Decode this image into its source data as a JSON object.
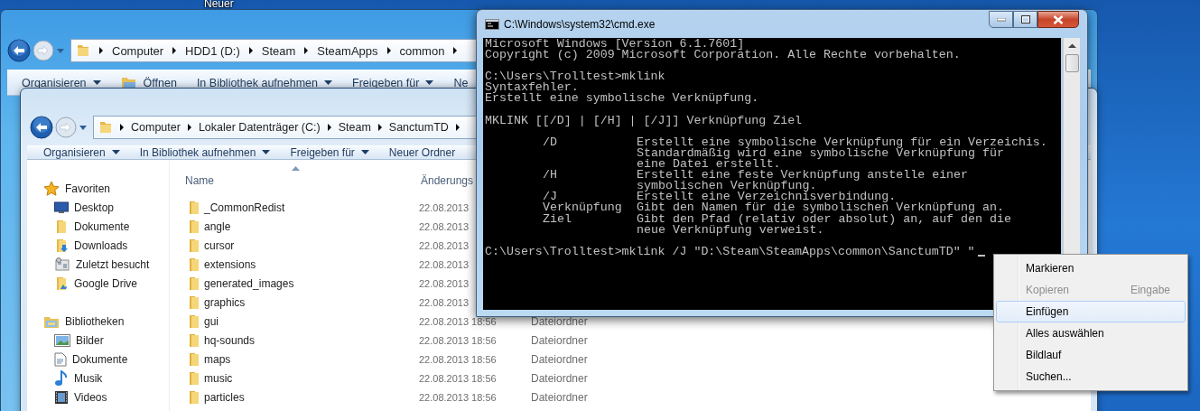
{
  "desktop": {
    "icon_label": "Neuer"
  },
  "back_explorer": {
    "address": [
      "Computer",
      "HDD1 (D:)",
      "Steam",
      "SteamApps",
      "common"
    ],
    "toolbar": [
      {
        "label": "Organisieren",
        "kind": "menu"
      },
      {
        "label": "Öffnen",
        "kind": "open"
      },
      {
        "label": "In Bibliothek aufnehmen",
        "kind": "menu"
      },
      {
        "label": "Freigeben für",
        "kind": "menu"
      },
      {
        "label": "Ne",
        "kind": "button"
      }
    ]
  },
  "front_explorer": {
    "address": [
      "Computer",
      "Lokaler Datenträger (C:)",
      "Steam",
      "SanctumTD"
    ],
    "toolbar": [
      {
        "label": "Organisieren",
        "kind": "menu"
      },
      {
        "label": "In Bibliothek aufnehmen",
        "kind": "menu"
      },
      {
        "label": "Freigeben für",
        "kind": "menu"
      },
      {
        "label": "Neuer Ordner",
        "kind": "button"
      }
    ],
    "navigation": [
      {
        "label": "Favoriten",
        "kind": "star",
        "children": [
          {
            "label": "Desktop",
            "kind": "desktop"
          },
          {
            "label": "Dokumente",
            "kind": "folder"
          },
          {
            "label": "Downloads",
            "kind": "download"
          },
          {
            "label": "Zuletzt besucht",
            "kind": "recent"
          },
          {
            "label": "Google Drive",
            "kind": "drive"
          }
        ]
      },
      {
        "label": "Bibliotheken",
        "kind": "library",
        "children": [
          {
            "label": "Bilder",
            "kind": "pictures"
          },
          {
            "label": "Dokumente",
            "kind": "document"
          },
          {
            "label": "Musik",
            "kind": "music"
          },
          {
            "label": "Videos",
            "kind": "video"
          }
        ]
      }
    ],
    "columns": [
      "Name",
      "Änderungs"
    ],
    "rows": [
      {
        "name": "_CommonRedist",
        "date": "22.08.2013"
      },
      {
        "name": "angle",
        "date": "22.08.2013"
      },
      {
        "name": "cursor",
        "date": "22.08.2013"
      },
      {
        "name": "extensions",
        "date": "22.08.2013"
      },
      {
        "name": "generated_images",
        "date": "22.08.2013"
      },
      {
        "name": "graphics",
        "date": "22.08.2013"
      },
      {
        "name": "gui",
        "date": "22.08.2013 18:56",
        "type": "Dateiordner"
      },
      {
        "name": "hq-sounds",
        "date": "22.08.2013 18:56",
        "type": "Dateiordner"
      },
      {
        "name": "maps",
        "date": "22.08.2013 18:56",
        "type": "Dateiordner"
      },
      {
        "name": "music",
        "date": "22.08.2013 18:56",
        "type": "Dateiordner"
      },
      {
        "name": "particles",
        "date": "22.08.2013 18:56",
        "type": "Dateiordner"
      }
    ]
  },
  "console": {
    "title": "C:\\Windows\\system32\\cmd.exe",
    "blocks": [
      [
        "Microsoft Windows [Version 6.1.7601]",
        "Copyright (c) 2009 Microsoft Corporation. Alle Rechte vorbehalten."
      ],
      [
        "C:\\Users\\Trolltest>mklink",
        "Syntaxfehler.",
        "Erstellt eine symbolische Verknüpfung."
      ],
      [
        "MKLINK [[/D] | [/H] | [/J]] Verknüpfung Ziel"
      ]
    ],
    "options": [
      {
        "flag": "/D",
        "text": [
          "Erstellt eine symbolische Verknüpfung für ein Verzeichis.",
          "Standardmäßig wird eine symbolische Verknüpfung für",
          "eine Datei erstellt."
        ]
      },
      {
        "flag": "/H",
        "text": [
          "Erstellt eine feste Verknüpfung anstelle einer",
          "symbolischen Verknüpfung."
        ]
      },
      {
        "flag": "/J",
        "text": [
          "Erstellt eine Verzeichnisverbindung."
        ]
      },
      {
        "flag": "Verknüpfung",
        "text": [
          "Gibt den Namen für die symbolischen Verknüpfung an."
        ]
      },
      {
        "flag": "Ziel",
        "text": [
          "Gibt den Pfad (relativ oder absolut) an, auf den die",
          "neue Verknüpfung verweist."
        ]
      }
    ],
    "prompt": "C:\\Users\\Trolltest>mklink /J \"D:\\Steam\\SteamApps\\common\\SanctumTD\" \""
  },
  "context_menu": {
    "items": [
      {
        "label": "Markieren",
        "disabled": false,
        "selected": false
      },
      {
        "label": "Kopieren",
        "shortcut": "Eingabe",
        "disabled": true,
        "selected": false
      },
      {
        "label": "Einfügen",
        "disabled": false,
        "selected": true
      },
      {
        "label": "Alles auswählen",
        "disabled": false,
        "selected": false
      },
      {
        "label": "Bildlauf",
        "disabled": false,
        "selected": false
      },
      {
        "label": "Suchen...",
        "disabled": false,
        "selected": false
      }
    ]
  }
}
